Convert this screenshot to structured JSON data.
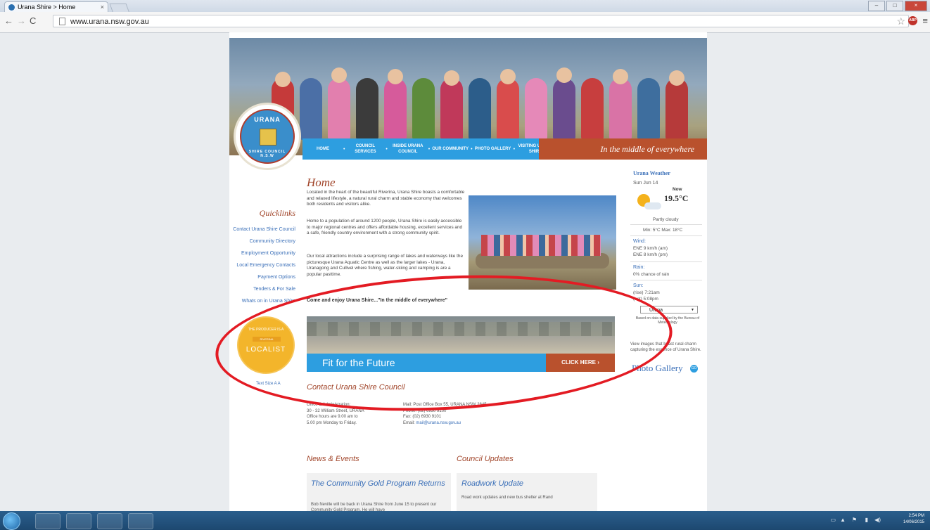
{
  "browser": {
    "tab_title": "Urana Shire > Home",
    "tab_close": "×",
    "url": "www.urana.nsw.gov.au",
    "window_controls": [
      "–",
      "□",
      "×"
    ]
  },
  "site": {
    "logo_text": "URANA",
    "logo_subtext": "SHIRE COUNCIL N.S.W",
    "nav": [
      {
        "label": "HOME"
      },
      {
        "label": "COUNCIL SERVICES"
      },
      {
        "label": "INSIDE URANA COUNCIL"
      },
      {
        "label": "OUR COMMUNITY"
      },
      {
        "label": "PHOTO GALLERY"
      },
      {
        "label": "VISITING URANA SHIRE"
      }
    ],
    "tagline": "In the middle of everywhere"
  },
  "quicklinks": {
    "title": "Quicklinks",
    "items": [
      "Contact Urana Shire Council",
      "Community Directory",
      "Employment Opportunity",
      "Local Emergency Contacts",
      "Payment Options",
      "Tenders & For Sale",
      "Whats on in Urana Shire"
    ],
    "badge_top": "THE PRODUCER IS A",
    "badge_mid": "RIVERINA",
    "badge_main": "LOCALIST",
    "text_size": "Text Size A A"
  },
  "main": {
    "title": "Home",
    "para1": "Located in the heart of the beautiful Riverina, Urana Shire boasts a comfortable and relaxed lifestyle, a natural rural charm and stable economy that welcomes both residents and visitors alike.",
    "para2": "Home to a population of around 1200 people, Urana Shire is easily accessible to major regional centres and offers affordable housing, excellent services and a safe, friendly country environment with a strong community spirit.",
    "para3": "Our local attractions include a surprising range of lakes and waterways like the picturesque Urana Aquatic Centre as well as the larger lakes - Urana, Uranagong and Cullivel where fishing, water-skiing and camping is are a popular pasttime.",
    "come_enjoy": "Come and enjoy Urana Shire...\"In the middle of everywhere\"",
    "banner_text": "Fit for the Future",
    "banner_cta": "CLICK HERE ›"
  },
  "contact": {
    "title": "Contact Urana Shire Council",
    "office_label": "Office & Administration:",
    "office_address": "30 - 32 William Street, URANA",
    "office_hours": "Office hours are 9.00 am to",
    "office_hours2": "5.00 pm Monday to Friday.",
    "mail": "Mail: Post Office Box 55, URANA NSW 2645",
    "phone": "Phone: (02) 6930 9100",
    "fax": "Fax: (02) 6930 9101",
    "email_label": "Email: ",
    "email": "mail@urana.nsw.gov.au"
  },
  "news": {
    "title": "News & Events",
    "item_title": "The Community Gold Program Returns",
    "item_text": "Bob Neville will be back in Urana Shire from June 15 to present our Community Gold Program. He will have"
  },
  "updates": {
    "title": "Council Updates",
    "item_title": "Roadwork Update",
    "item_text": "Road work updates and new bus shelter at Rand"
  },
  "weather": {
    "title": "Urana Weather",
    "date": "Sun Jun 14",
    "now_label": "Now",
    "now_temp": "19.5°C",
    "condition": "Partly cloudy",
    "minmax": "Min: 5°C   Max: 18°C",
    "wind_label": "Wind:",
    "wind_am": "ENE 9 km/h (am)",
    "wind_pm": "ENE 8 km/h (pm)",
    "rain_label": "Rain:",
    "rain": "0% chance of rain",
    "sun_label": "Sun:",
    "sunrise": "(rise) 7:21am",
    "sunset": "(set) 5:08pm",
    "location": "Urana",
    "credit": "Based on data supplied by the Bureau of Meteorology",
    "gallery_text": "View images that boast rural charm capturing the essence of Urana Shire.",
    "gallery_link": "Photo Gallery",
    "gallery_icon": "GO"
  },
  "taskbar": {
    "time": "2:54 PM",
    "date": "14/06/2015",
    "apps": [
      "windows-explorer-icon",
      "media-player-icon",
      "chrome-icon",
      "word-icon"
    ]
  }
}
